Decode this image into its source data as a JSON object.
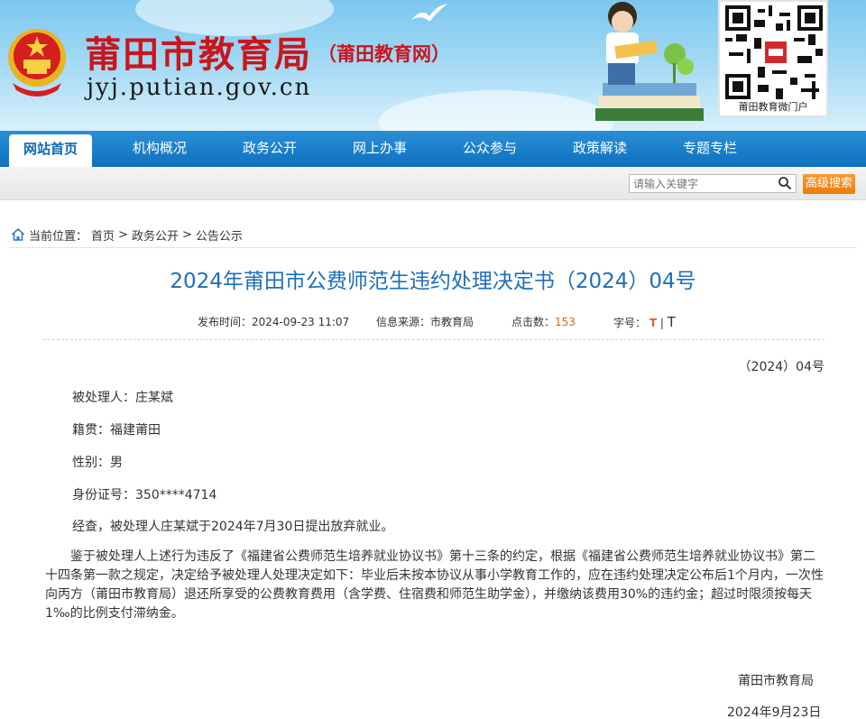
{
  "header": {
    "site_title": "莆田市教育局",
    "site_subtitle": "（莆田教育网）",
    "domain": "jyj.putian.gov.cn",
    "qr_label": "莆田教育微门户"
  },
  "nav": {
    "items": [
      {
        "label": "网站首页"
      },
      {
        "label": "机构概况"
      },
      {
        "label": "政务公开"
      },
      {
        "label": "网上办事"
      },
      {
        "label": "公众参与"
      },
      {
        "label": "政策解读"
      },
      {
        "label": "专题专栏"
      }
    ]
  },
  "search": {
    "placeholder": "请输入关键字",
    "advanced_label": "高级搜索"
  },
  "breadcrumb": {
    "prefix": "当前位置：",
    "items": [
      "首页",
      "政务公开",
      "公告公示"
    ],
    "separator": ">"
  },
  "article": {
    "title": "2024年莆田市公费师范生违约处理决定书（2024）04号",
    "meta": {
      "publish_label": "发布时间：",
      "publish_time": "2024-09-23 11:07",
      "source_label": "信息来源：",
      "source": "市教育局",
      "hits_label": "点击数：",
      "hits": "153",
      "font_label": "字号：",
      "font_large": "T",
      "font_sep": "|",
      "font_small": "T"
    },
    "doc_no": "（2024）04号",
    "fields": [
      "被处理人：庄某斌",
      "籍贯：福建莆田",
      "性别：男",
      "身份证号：350****4714",
      "经查，被处理人庄某斌于2024年7月30日提出放弃就业。"
    ],
    "body": "　　鉴于被处理人上述行为违反了《福建省公费师范生培养就业协议书》第十三条的约定，根据《福建省公费师范生培养就业协议书》第二十四条第一款之规定，决定给予被处理人处理决定如下：毕业后未按本协议从事小学教育工作的，应在违约处理决定公布后1个月内，一次性向丙方（莆田市教育局）退还所享受的公费教育费用（含学费、住宿费和师范生助学金），并缴纳该费用30%的违约金；超过时限须按每天1‰的比例支付滞纳金。",
    "signer": "莆田市教育局",
    "date": "2024年9月23日"
  },
  "colors": {
    "nav_blue": "#0e70bf",
    "title_blue": "#1e6fb8",
    "brand_red": "#c9161d",
    "accent_orange": "#ef7a0a"
  }
}
